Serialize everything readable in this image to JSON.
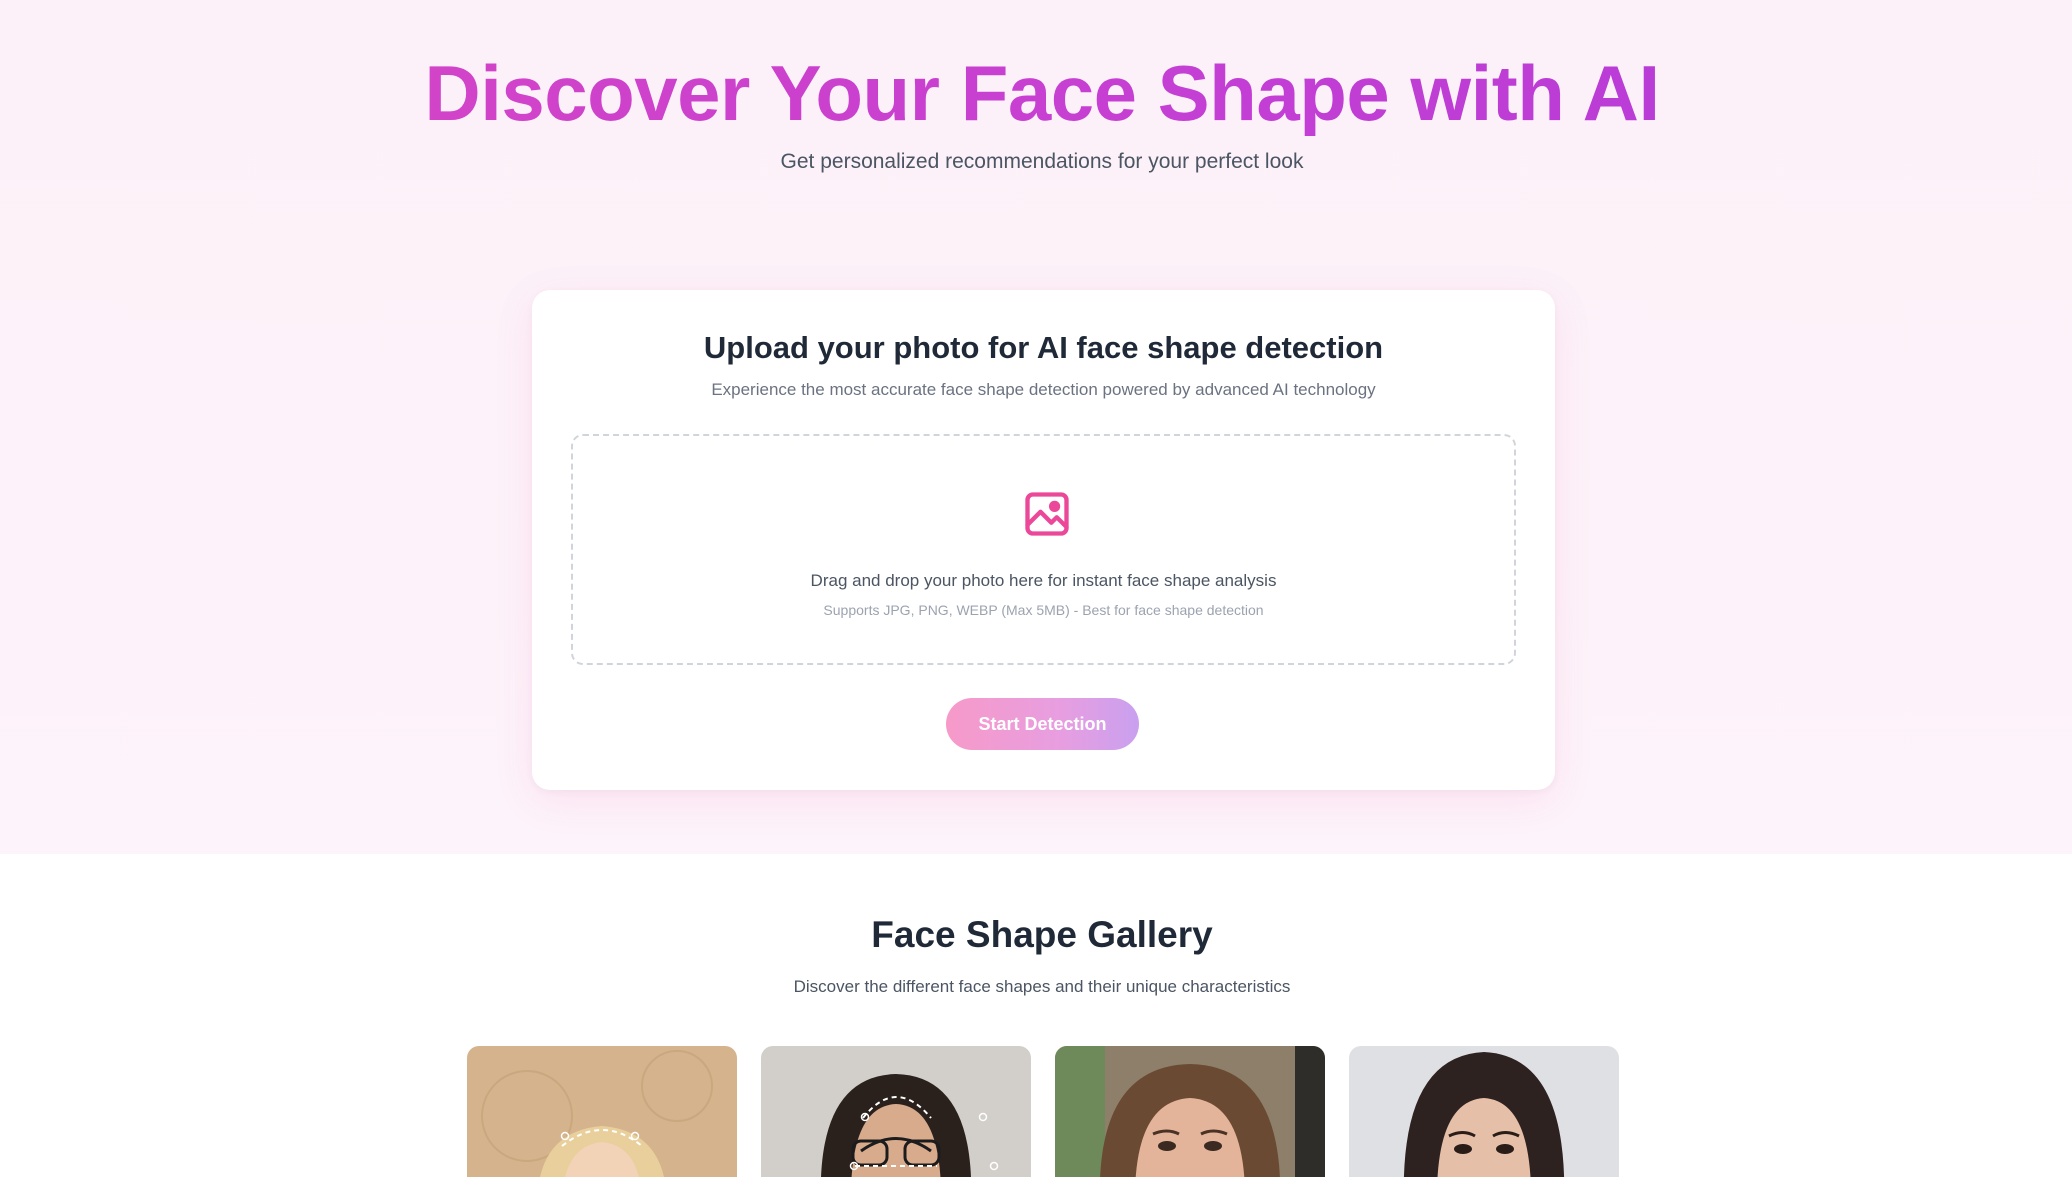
{
  "hero": {
    "title": "Discover Your Face Shape with AI",
    "subtitle": "Get personalized recommendations for your perfect look"
  },
  "upload": {
    "title": "Upload your photo for AI face shape detection",
    "subtitle": "Experience the most accurate face shape detection powered by advanced AI technology",
    "drop_text": "Drag and drop your photo here for instant face shape analysis",
    "drop_hint": "Supports JPG, PNG, WEBP (Max 5MB) - Best for face shape detection",
    "icon": "image-icon",
    "button_label": "Start Detection"
  },
  "gallery": {
    "title": "Face Shape Gallery",
    "subtitle": "Discover the different face shapes and their unique characteristics"
  },
  "colors": {
    "accent_pink": "#ec4899",
    "title_gradient_start": "#d946c2",
    "title_gradient_end": "#b13ad8",
    "hero_background": "#fcf1f8"
  }
}
